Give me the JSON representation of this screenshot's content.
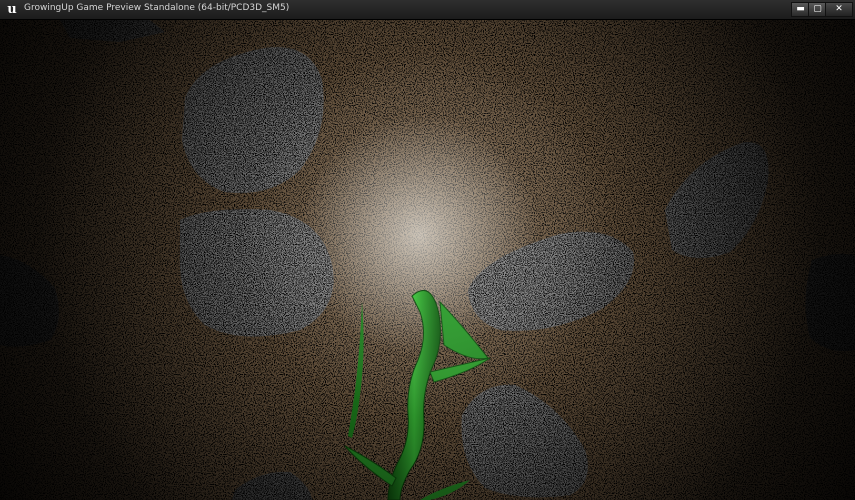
{
  "window": {
    "title": "GrowingUp Game Preview Standalone (64-bit/PCD3D_SM5)",
    "app_icon_glyph": "u",
    "buttons": {
      "minimize": "▬",
      "maximize": "▢",
      "close": "✕"
    }
  },
  "colors": {
    "titlebar": "#252525",
    "ground": "#7a6448",
    "rock": "#8a8a8a",
    "vine": "#2ea82a"
  }
}
